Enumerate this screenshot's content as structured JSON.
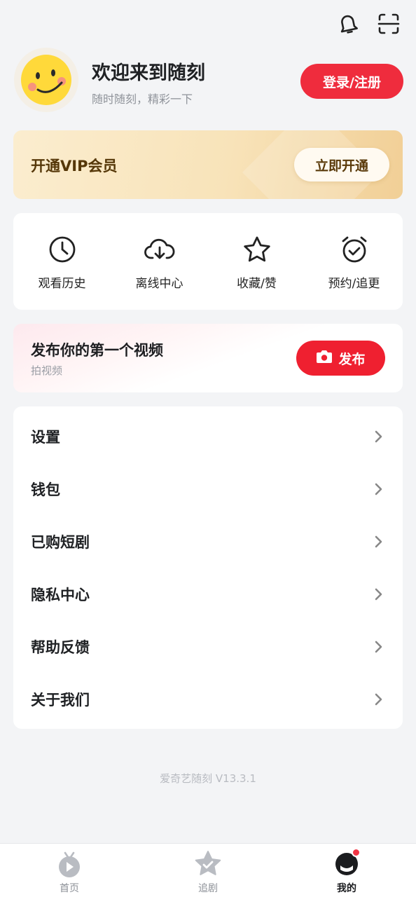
{
  "header": {
    "icons": [
      "bell-icon",
      "scan-icon"
    ]
  },
  "profile": {
    "welcome": "欢迎来到随刻",
    "slogan": "随时随刻，精彩一下",
    "login_label": "登录/注册"
  },
  "vip": {
    "title": "开通VIP会员",
    "button_label": "立即开通"
  },
  "shortcuts": [
    {
      "label": "观看历史",
      "icon": "clock-icon"
    },
    {
      "label": "离线中心",
      "icon": "cloud-download-icon"
    },
    {
      "label": "收藏/赞",
      "icon": "star-icon"
    },
    {
      "label": "预约/追更",
      "icon": "alarm-clock-icon"
    }
  ],
  "publish": {
    "title": "发布你的第一个视频",
    "subtitle": "拍视频",
    "button_label": "发布"
  },
  "menu": [
    {
      "label": "设置"
    },
    {
      "label": "钱包"
    },
    {
      "label": "已购短剧"
    },
    {
      "label": "隐私中心"
    },
    {
      "label": "帮助反馈"
    },
    {
      "label": "关于我们"
    }
  ],
  "version": "爱奇艺随刻 V13.3.1",
  "tabs": [
    {
      "label": "首页",
      "icon": "tv-icon"
    },
    {
      "label": "追剧",
      "icon": "star-check-icon"
    },
    {
      "label": "我的",
      "icon": "profile-face-icon"
    }
  ],
  "colors": {
    "brand_red": "#ef2c3d",
    "vip_gold": "#f8e3b9",
    "background": "#f3f4f6"
  }
}
